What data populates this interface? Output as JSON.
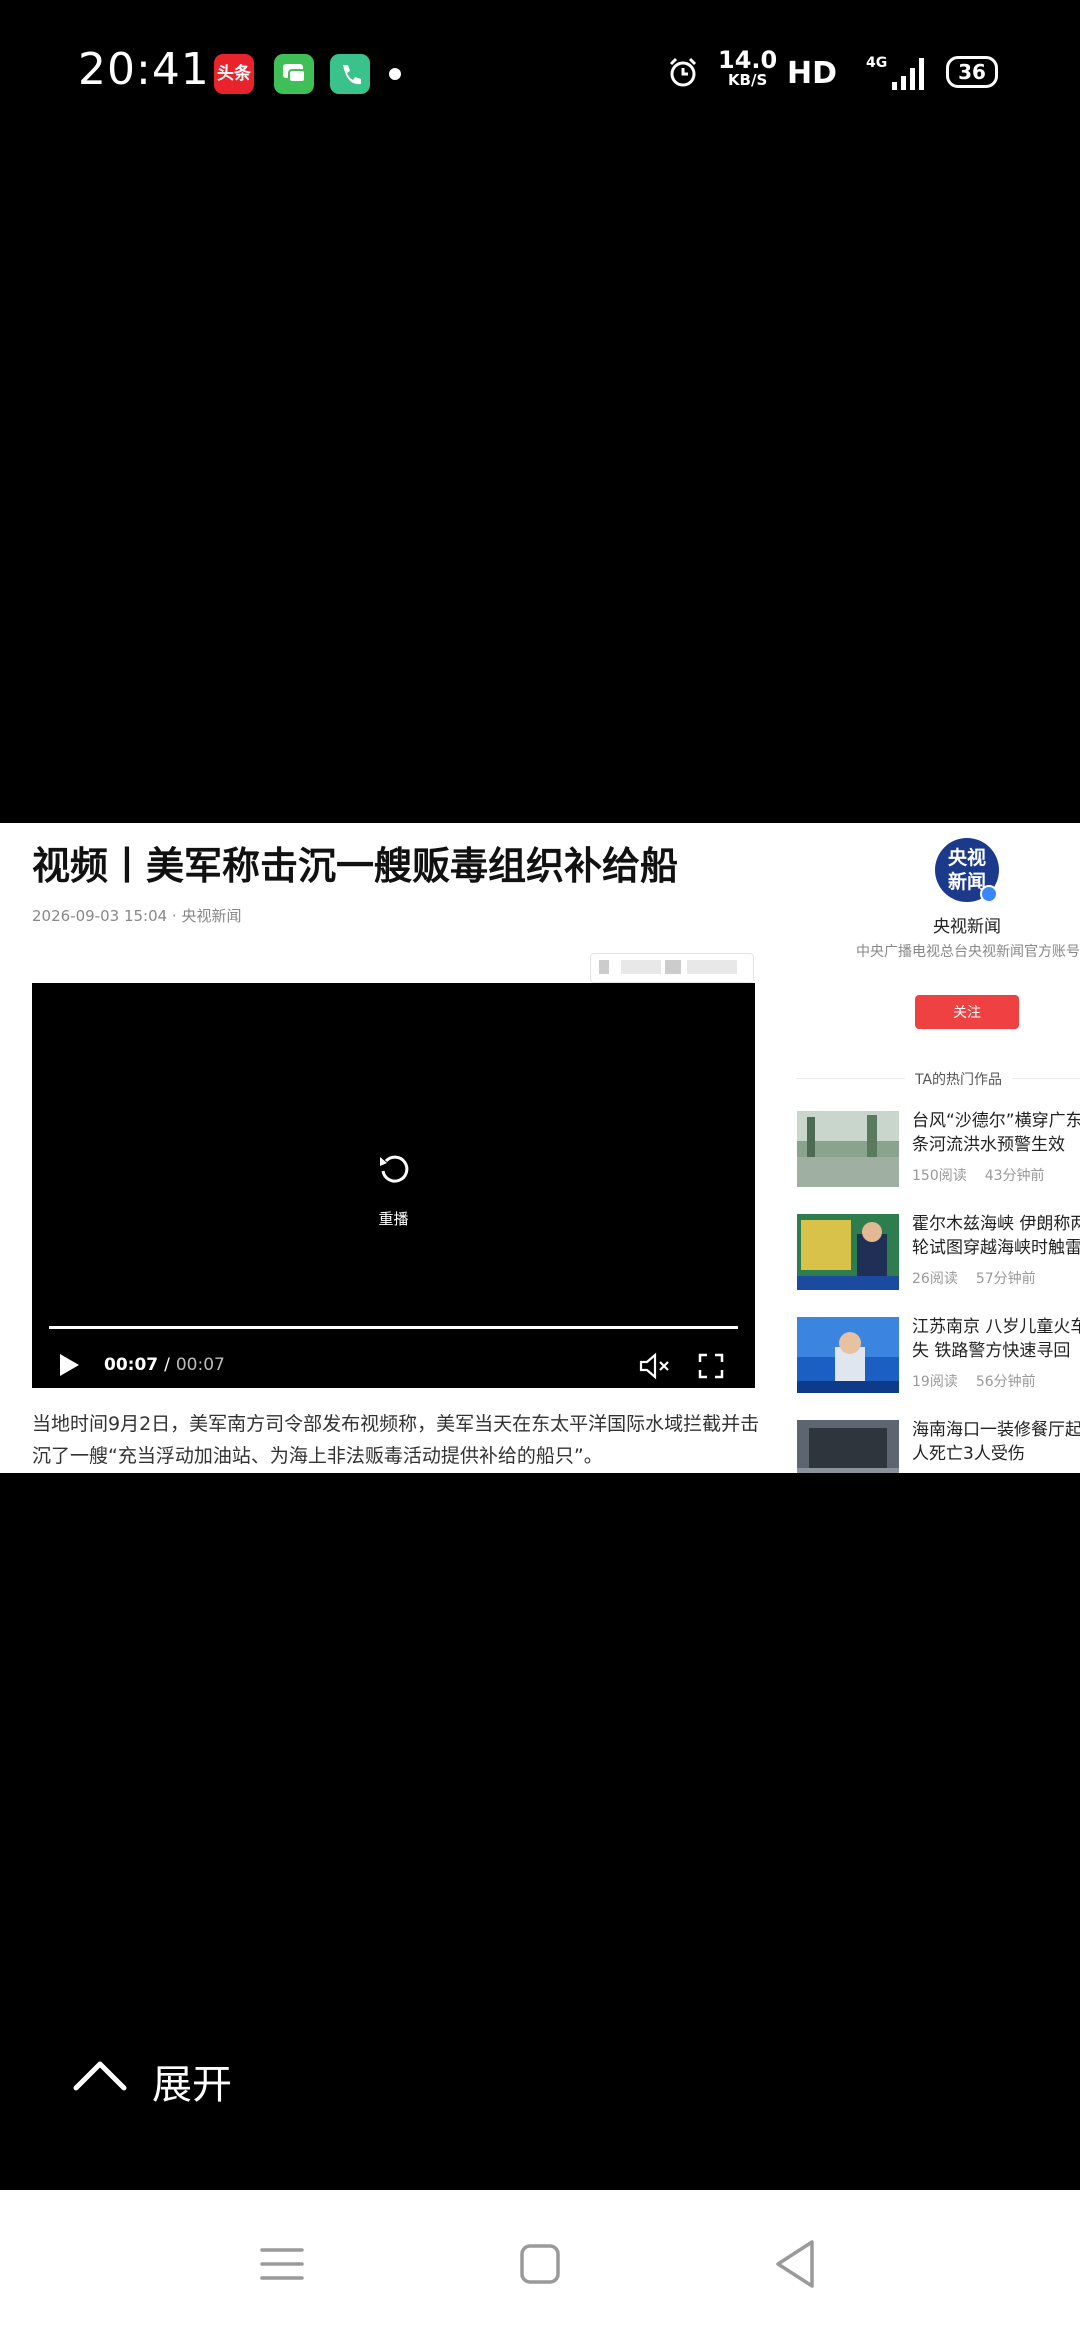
{
  "status_bar": {
    "time": "20:41",
    "app_icons": [
      "toutiao-icon",
      "messages-icon",
      "phone-icon"
    ],
    "toutiao_label": "头条",
    "net_speed_value": "14.0",
    "net_speed_unit": "KB/S",
    "hd_label": "HD",
    "network_type": "4G",
    "battery": "36"
  },
  "article": {
    "title": "视频丨美军称击沉一艘贩毒组织补给船",
    "meta": "2026-09-03 15:04 · 央视新闻",
    "body": "当地时间9月2日，美军南方司令部发布视频称，美军当天在东太平洋国际水域拦截并击沉了一艘“充当浮动加油站、为海上非法贩毒活动提供补给的船只”。"
  },
  "player": {
    "replay_label": "重播",
    "current_time": "00:07",
    "separator": "/",
    "duration": "00:07",
    "progress_fraction": 1.0
  },
  "sidebar": {
    "avatar_text_line1": "央视",
    "avatar_text_line2": "新闻",
    "account_name": "央视新闻",
    "account_desc": "中央广播电视总台央视新闻官方账号",
    "follow_label": "关注",
    "hot_title": "TA的热门作品",
    "items": [
      {
        "title_line1": "台风“沙德尔”横穿广东",
        "title_line2": "条河流洪水预警生效",
        "reads": "150阅读",
        "time": "43分钟前"
      },
      {
        "title_line1": "霍尔木兹海峡 伊朗称两",
        "title_line2": "轮试图穿越海峡时触雷",
        "reads": "26阅读",
        "time": "57分钟前"
      },
      {
        "title_line1": "江苏南京 八岁儿童火车",
        "title_line2": "失 铁路警方快速寻回",
        "reads": "19阅读",
        "time": "56分钟前"
      },
      {
        "title_line1": "海南海口一装修餐厅起",
        "title_line2": "人死亡3人受伤",
        "reads": "",
        "time": ""
      }
    ]
  },
  "expand": {
    "label": "展开"
  },
  "nav_bar": {
    "buttons": [
      "menu-icon",
      "home-icon",
      "back-icon"
    ]
  }
}
